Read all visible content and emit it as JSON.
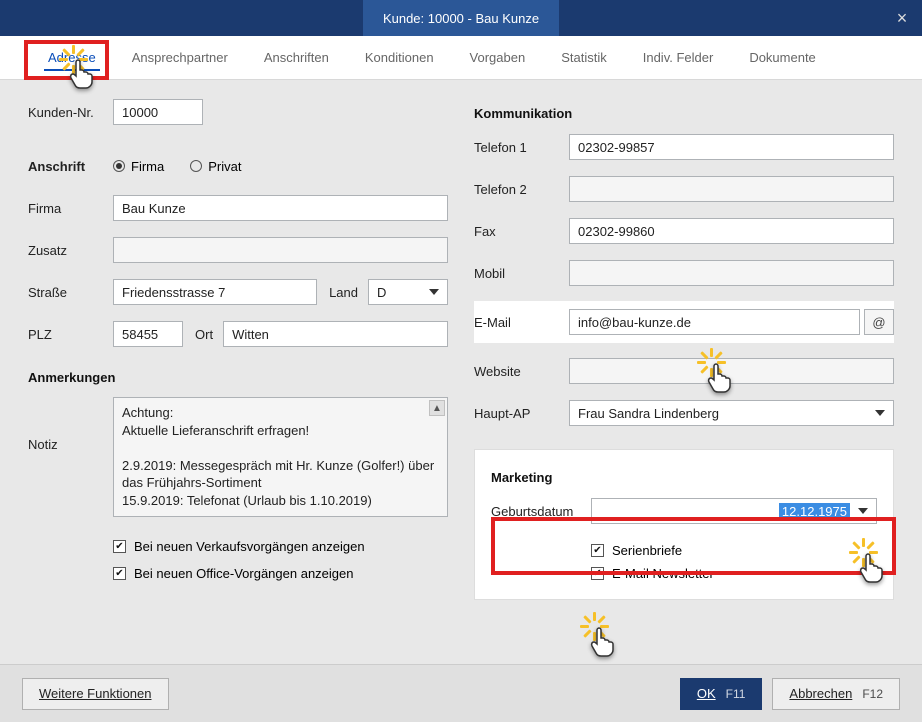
{
  "title": "Kunde: 10000 - Bau Kunze",
  "tabs": {
    "items": [
      "Adresse",
      "Ansprechpartner",
      "Anschriften",
      "Konditionen",
      "Vorgaben",
      "Statistik",
      "Indiv. Felder",
      "Dokumente"
    ],
    "active_index": 0
  },
  "left": {
    "kundenNr": {
      "label": "Kunden-Nr.",
      "value": "10000"
    },
    "anschrift": {
      "label": "Anschrift",
      "firma": "Firma",
      "privat": "Privat",
      "selected": "firma"
    },
    "firma": {
      "label": "Firma",
      "value": "Bau Kunze"
    },
    "zusatz": {
      "label": "Zusatz",
      "value": ""
    },
    "strasse": {
      "label": "Straße",
      "value": "Friedensstrasse 7"
    },
    "land": {
      "label": "Land",
      "value": "D"
    },
    "plz": {
      "label": "PLZ",
      "value": "58455"
    },
    "ort": {
      "label": "Ort",
      "value": "Witten"
    },
    "anmerkungen": {
      "heading": "Anmerkungen"
    },
    "notiz": {
      "label": "Notiz",
      "value": "Achtung:\nAktuelle Lieferanschrift erfragen!\n\n2.9.2019: Messegespräch mit Hr. Kunze (Golfer!) über das Frühjahrs-Sortiment\n15.9.2019: Telefonat (Urlaub bis 1.10.2019)"
    },
    "chk1": {
      "label": "Bei neuen Verkaufsvorgängen anzeigen",
      "checked": true
    },
    "chk2": {
      "label": "Bei neuen Office-Vorgängen anzeigen",
      "checked": true
    }
  },
  "right": {
    "kommunikationHeading": "Kommunikation",
    "telefon1": {
      "label": "Telefon 1",
      "value": "02302-99857"
    },
    "telefon2": {
      "label": "Telefon 2",
      "value": ""
    },
    "fax": {
      "label": "Fax",
      "value": "02302-99860"
    },
    "mobil": {
      "label": "Mobil",
      "value": ""
    },
    "email": {
      "label": "E-Mail",
      "value": "info@bau-kunze.de"
    },
    "website": {
      "label": "Website",
      "value": ""
    },
    "hauptAp": {
      "label": "Haupt-AP",
      "value": "Frau Sandra Lindenberg"
    },
    "marketing": {
      "heading": "Marketing",
      "geburtsdatum": {
        "label": "Geburtsdatum",
        "value": "12.12.1975"
      },
      "serienbriefe": {
        "label": "Serienbriefe",
        "checked": true
      },
      "newsletter": {
        "label": "E-Mail Newsletter",
        "checked": true
      }
    }
  },
  "footer": {
    "weitere": "Weitere Funktionen",
    "ok": "OK",
    "ok_sc": "F11",
    "abbrechen": "Abbrechen",
    "abbrechen_sc": "F12"
  }
}
